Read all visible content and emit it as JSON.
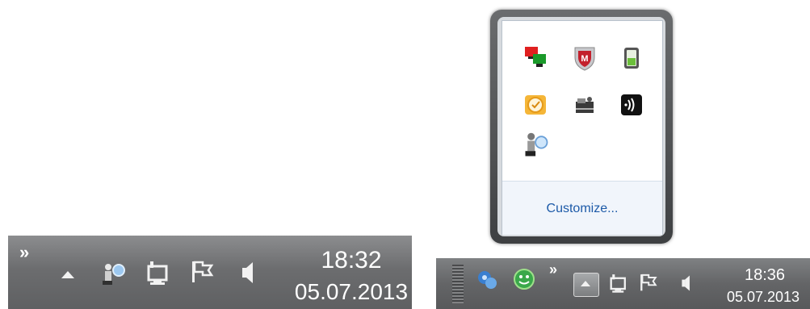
{
  "taskbar_left": {
    "overflow_label": "»",
    "time": "18:32",
    "date": "05.07.2013",
    "icons": [
      "show-hidden-icons",
      "network-scan-icon",
      "network-icon",
      "action-center-flag-icon",
      "speaker-icon"
    ]
  },
  "taskbar_right": {
    "overflow_label": "»",
    "time": "18:36",
    "date": "05.07.2013",
    "icons": [
      "bluetooth-icon",
      "smiley-app-icon",
      "show-hidden-icons-button",
      "network-icon",
      "action-center-flag-icon",
      "speaker-icon"
    ]
  },
  "popup": {
    "customize_label": "Customize...",
    "icons": [
      "remote-desktop-icon",
      "mcafee-shield-icon",
      "battery-device-icon",
      "outlook-reminder-icon",
      "scanner-icon",
      "nfc-wireless-icon",
      "network-scan-icon"
    ]
  },
  "colors": {
    "link": "#1d5aa8",
    "taskbar": "#6c6d6f",
    "popup_border": "#4a4c4e"
  }
}
